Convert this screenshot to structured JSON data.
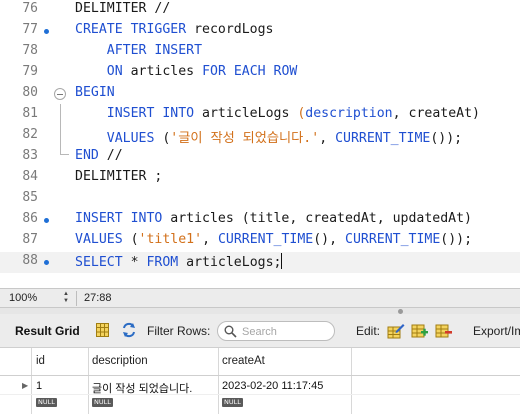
{
  "editor": {
    "lines": [
      {
        "n": "76",
        "dot": false,
        "fold": false,
        "current": false,
        "tokens": [
          [
            "p",
            "DELIMITER //"
          ]
        ]
      },
      {
        "n": "77",
        "dot": true,
        "fold": false,
        "current": false,
        "tokens": [
          [
            "k",
            "CREATE TRIGGER"
          ],
          [
            "p",
            " recordLogs"
          ]
        ]
      },
      {
        "n": "78",
        "dot": false,
        "fold": false,
        "current": false,
        "tokens": [
          [
            "p",
            "    "
          ],
          [
            "k",
            "AFTER INSERT"
          ]
        ]
      },
      {
        "n": "79",
        "dot": false,
        "fold": false,
        "current": false,
        "tokens": [
          [
            "p",
            "    "
          ],
          [
            "k",
            "ON"
          ],
          [
            "p",
            " articles "
          ],
          [
            "k",
            "FOR EACH ROW"
          ]
        ]
      },
      {
        "n": "80",
        "dot": false,
        "fold": true,
        "current": false,
        "tokens": [
          [
            "k",
            "BEGIN"
          ]
        ]
      },
      {
        "n": "81",
        "dot": false,
        "fold": false,
        "current": false,
        "tokens": [
          [
            "p",
            "    "
          ],
          [
            "k",
            "INSERT INTO"
          ],
          [
            "p",
            " articleLogs "
          ],
          [
            "s",
            "("
          ],
          [
            "k",
            "description"
          ],
          [
            "p",
            ", createAt)"
          ]
        ]
      },
      {
        "n": "82",
        "dot": false,
        "fold": false,
        "current": false,
        "tokens": [
          [
            "p",
            "    "
          ],
          [
            "k",
            "VALUES"
          ],
          [
            "p",
            " ("
          ],
          [
            "s",
            "'글이 작성 되었습니다.'"
          ],
          [
            "p",
            ", "
          ],
          [
            "k",
            "CURRENT_TIME"
          ],
          [
            "p",
            "());"
          ]
        ]
      },
      {
        "n": "83",
        "dot": false,
        "fold": false,
        "current": false,
        "tokens": [
          [
            "k",
            "END"
          ],
          [
            "p",
            " //"
          ]
        ]
      },
      {
        "n": "84",
        "dot": false,
        "fold": false,
        "current": false,
        "tokens": [
          [
            "p",
            "DELIMITER ;"
          ]
        ]
      },
      {
        "n": "85",
        "dot": false,
        "fold": false,
        "current": false,
        "tokens": []
      },
      {
        "n": "86",
        "dot": true,
        "fold": false,
        "current": false,
        "tokens": [
          [
            "k",
            "INSERT INTO"
          ],
          [
            "p",
            " articles (title, createdAt, updatedAt)"
          ]
        ]
      },
      {
        "n": "87",
        "dot": false,
        "fold": false,
        "current": false,
        "tokens": [
          [
            "k",
            "VALUES"
          ],
          [
            "p",
            " ("
          ],
          [
            "s",
            "'title1'"
          ],
          [
            "p",
            ", "
          ],
          [
            "k",
            "CURRENT_TIME"
          ],
          [
            "p",
            "(), "
          ],
          [
            "k",
            "CURRENT_TIME"
          ],
          [
            "p",
            "());"
          ]
        ]
      },
      {
        "n": "88",
        "dot": true,
        "fold": false,
        "current": true,
        "tokens": [
          [
            "k",
            "SELECT"
          ],
          [
            "p",
            " * "
          ],
          [
            "k",
            "FROM"
          ],
          [
            "p",
            " articleLogs;"
          ]
        ]
      }
    ]
  },
  "status_bar": {
    "zoom": "100%",
    "cursor_position": "27:88"
  },
  "result_toolbar": {
    "title": "Result Grid",
    "filter_label": "Filter Rows:",
    "search_placeholder": "Search",
    "edit_label": "Edit:",
    "export_label": "Export/Im"
  },
  "result_grid": {
    "columns": [
      "id",
      "description",
      "createAt"
    ],
    "rows": [
      [
        "1",
        "글이 작성 되었습니다.",
        "2023-02-20 11:17:45"
      ]
    ],
    "null_row": [
      "NULL",
      "NULL",
      "NULL"
    ]
  },
  "colors": {
    "keyword": "#1f4fd1",
    "string": "#d2701a",
    "line_dot": "#1f6fd6"
  },
  "icons": [
    "grid-view-icon",
    "refresh-icon",
    "search-icon",
    "edit-row-icon",
    "add-row-icon",
    "delete-row-icon",
    "fold-toggle-icon"
  ]
}
